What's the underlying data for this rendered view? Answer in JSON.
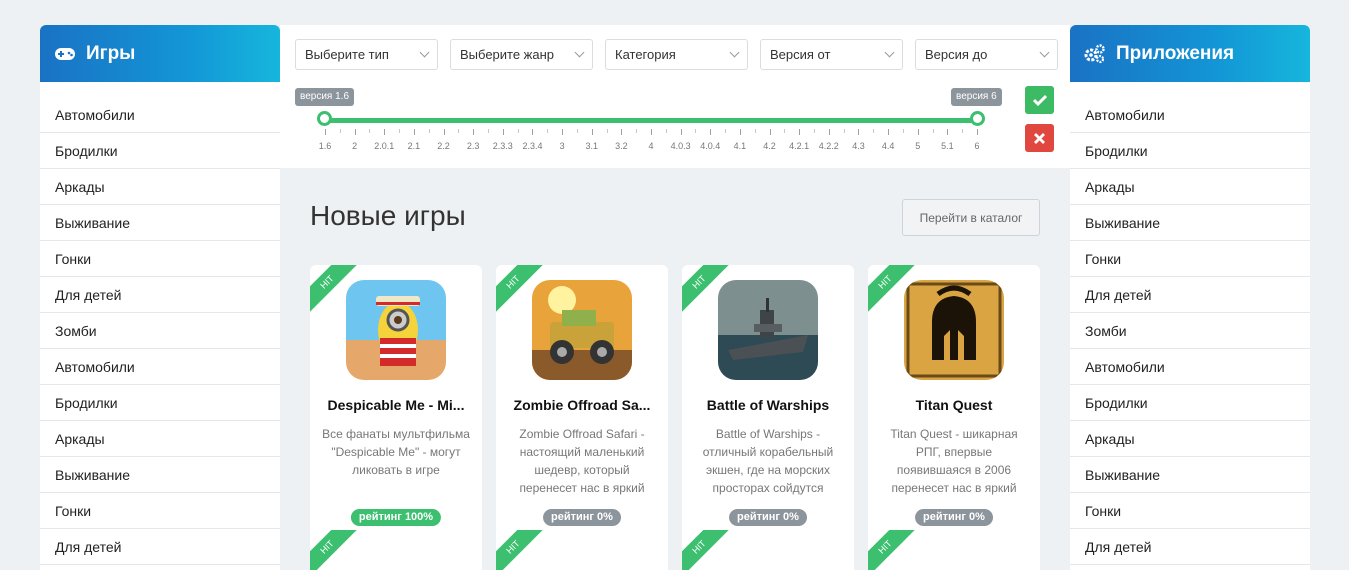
{
  "games_sidebar": {
    "title": "Игры",
    "icon": "gamepad-icon",
    "items": [
      "Автомобили",
      "Бродилки",
      "Аркады",
      "Выживание",
      "Гонки",
      "Для детей",
      "Зомби",
      "Автомобили",
      "Бродилки",
      "Аркады",
      "Выживание",
      "Гонки",
      "Для детей"
    ]
  },
  "apps_sidebar": {
    "title": "Приложения",
    "icon": "gears-icon",
    "items": [
      "Автомобили",
      "Бродилки",
      "Аркады",
      "Выживание",
      "Гонки",
      "Для детей",
      "Зомби",
      "Автомобили",
      "Бродилки",
      "Аркады",
      "Выживание",
      "Гонки",
      "Для детей"
    ]
  },
  "filters": {
    "type": "Выберите тип",
    "genre": "Выберите жанр",
    "category": "Категория",
    "version_from": "Версия от",
    "version_to": "Версия до"
  },
  "version_slider": {
    "min_label": "версия 1.6",
    "max_label": "версия 6",
    "ticks": [
      "1.6",
      "2",
      "2.0.1",
      "2.1",
      "2.2",
      "2.3",
      "2.3.3",
      "2.3.4",
      "3",
      "3.1",
      "3.2",
      "4",
      "4.0.3",
      "4.0.4",
      "4.1",
      "4.2",
      "4.2.1",
      "4.2.2",
      "4.3",
      "4.4",
      "5",
      "5.1",
      "6"
    ]
  },
  "section": {
    "title": "Новые игры",
    "catalog_button": "Перейти в каталог"
  },
  "cards": [
    {
      "ribbon": "HIT",
      "title": "Despicable Me - Mi...",
      "desc": "Все фанаты мультфильма \"Despicable Me\" - могут ликовать в игре",
      "rating": "рейтинг 100%",
      "rating_color": "#3cc070"
    },
    {
      "ribbon": "HIT",
      "title": "Zombie Offroad Sa...",
      "desc": "Zombie Offroad Safari - настоящий маленький шедевр, который перенесет нас в яркий",
      "rating": "рейтинг 0%",
      "rating_color": "#8d959c"
    },
    {
      "ribbon": "HIT",
      "title": "Battle of Warships",
      "desc": "Battle of Warships - отличный корабельный экшен, где на морских просторах сойдутся",
      "rating": "рейтинг 0%",
      "rating_color": "#8d959c"
    },
    {
      "ribbon": "HIT",
      "title": "Titan Quest",
      "desc": "Titan Quest - шикарная РПГ, впервые появившаяся в 2006 перенесет нас в яркий",
      "rating": "рейтинг 0%",
      "rating_color": "#8d959c"
    }
  ],
  "second_row_ribbons": [
    "HIT",
    "HIT",
    "HIT",
    "HIT"
  ],
  "colors": {
    "accent_green": "#3cc070",
    "header_gradient_start": "#1a72c4",
    "header_gradient_end": "#16b6dc",
    "danger": "#e0483f"
  }
}
